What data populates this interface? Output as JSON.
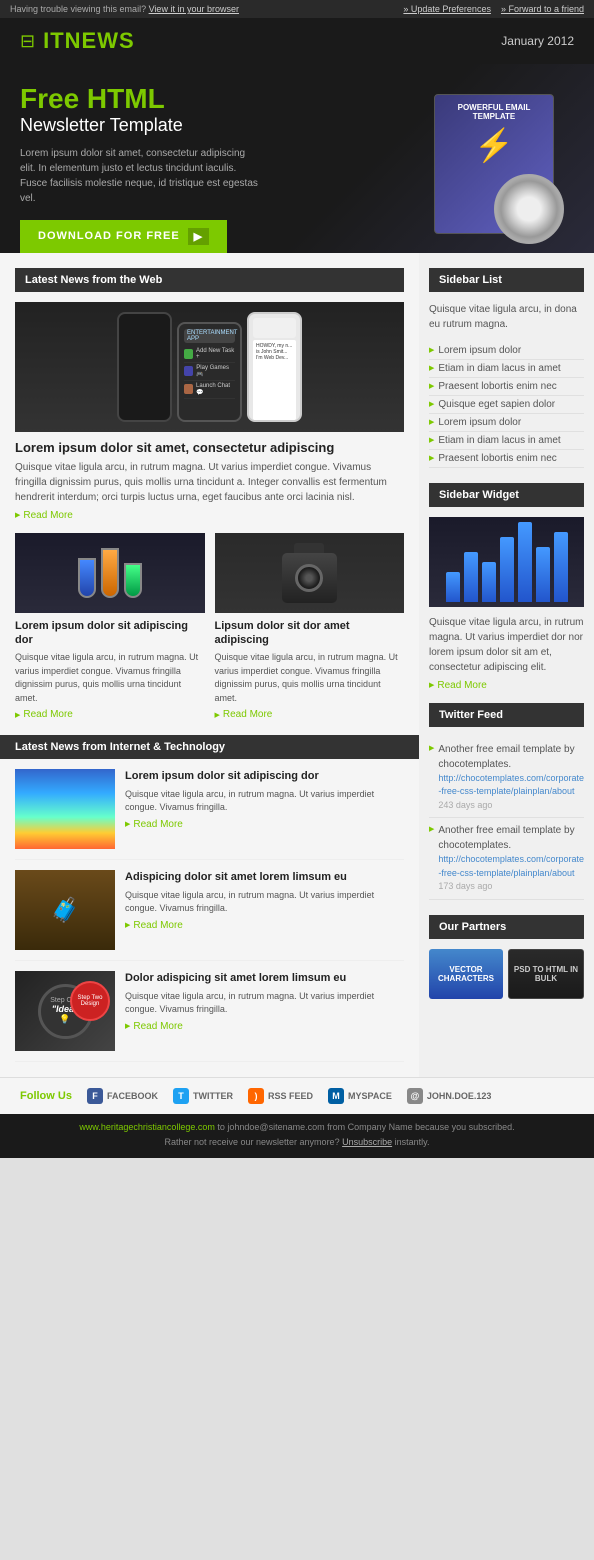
{
  "topbar": {
    "trouble_text": "Having trouble viewing this email?",
    "view_link": "View it in your browser",
    "update_link": "» Update Preferences",
    "forward_link": "» Forward to a friend"
  },
  "header": {
    "logo": "ITNEWS",
    "date": "January 2012"
  },
  "hero": {
    "title": "Free HTML",
    "subtitle": "Newsletter Template",
    "body": "Lorem ipsum dolor sit amet, consectetur adipiscing elit. In elementum justo et lectus tincidunt iaculis. Fusce facilisis molestie neque, id tristique est egestas vel.",
    "btn_label": "DOWNLOAD FOR FREE",
    "cd_title": "POWERFUL EMAIL TEMPLATE"
  },
  "latest_news": {
    "section_title": "Latest News from the Web",
    "article1": {
      "title": "Lorem ipsum dolor sit amet, consectetur adipiscing",
      "body": "Quisque vitae ligula arcu, in rutrum magna. Ut varius imperdiet congue. Vivamus fringilla dignissim purus, quis mollis urna tincidunt a. Integer convallis est fermentum hendrerit interdum; orci turpis luctus urna, eget faucibus ante orci lacinia nisl.",
      "read_more": "Read More"
    },
    "article2": {
      "title": "Lorem ipsum dolor sit adipiscing dor",
      "body": "Quisque vitae ligula arcu, in rutrum magna. Ut varius imperdiet congue. Vivamus fringilla dignissim purus, quis mollis urna tincidunt amet.",
      "read_more": "Read More"
    },
    "article3": {
      "title": "Lipsum dolor sit dor amet adipiscing",
      "body": "Quisque vitae ligula arcu, in rutrum magna. Ut varius imperdiet congue. Vivamus fringilla dignissim purus, quis mollis urna tincidunt amet.",
      "read_more": "Read More"
    }
  },
  "tech_news": {
    "section_title": "Latest News from Internet & Technology",
    "items": [
      {
        "title": "Lorem ipsum dolor sit adipiscing dor",
        "body": "Quisque vitae ligula arcu, in rutrum magna. Ut varius imperdiet congue. Vivamus fringilla.",
        "read_more": "Read More"
      },
      {
        "title": "Adispicing dolor sit amet lorem limsum eu",
        "body": "Quisque vitae ligula arcu, in rutrum magna. Ut varius imperdiet congue. Vivamus fringilla.",
        "read_more": "Read More"
      },
      {
        "title": "Dolor adispicing sit amet lorem limsum eu",
        "body": "Quisque vitae ligula arcu, in rutrum magna. Ut varius imperdiet congue. Vivamus fringilla.",
        "read_more": "Read More"
      }
    ]
  },
  "sidebar": {
    "list_title": "Sidebar List",
    "list_desc": "Quisque vitae ligula arcu, in dona eu rutrum magna.",
    "list_items": [
      "Lorem ipsum dolor",
      "Etiam in diam lacus in amet",
      "Praesent lobortis enim nec",
      "Quisque eget sapien dolor",
      "Lorem ipsum dolor",
      "Etiam in diam lacus in amet",
      "Praesent lobortis enim nec"
    ],
    "widget_title": "Sidebar Widget",
    "widget_desc": "Quisque vitae ligula arcu, in rutrum magna. Ut varius imperdiet dor nor lorem ipsum dolor sit am et, consectetur adipiscing elit.",
    "widget_read_more": "Read More",
    "bars": [
      30,
      50,
      40,
      65,
      80,
      55,
      70
    ],
    "twitter_title": "Twitter Feed",
    "tweets": [
      {
        "text": "Another free email template by chocotemplates.",
        "url": "http://chocotemplates.com/corporate-free-css-template/plainplan/about",
        "time": "243 days ago"
      },
      {
        "text": "Another free email template by chocotemplates.",
        "url": "http://chocotemplates.com/corporate-free-css-template/plainplan/about",
        "time": "173 days ago"
      }
    ],
    "partners_title": "Our Partners",
    "partners": [
      {
        "label": "VECTOR CHARACTERS",
        "type": "vector"
      },
      {
        "label": "PSD TO HTML IN BULK",
        "type": "psd"
      }
    ]
  },
  "follow": {
    "label": "Follow Us",
    "items": [
      {
        "icon": "fb",
        "label": "FACEBOOK"
      },
      {
        "icon": "tw",
        "label": "TWITTER"
      },
      {
        "icon": "rss",
        "label": "RSS FEED"
      },
      {
        "icon": "ms",
        "label": "MYSPACE"
      },
      {
        "icon": "email",
        "label": "JOHN.DOE.123"
      }
    ]
  },
  "footer": {
    "url": "www.heritagechristiancollege.com",
    "text": "to johndoe@sitename.com from Company Name because you subscribed.",
    "unsubscribe_prefix": "Rather not receive our newsletter anymore?",
    "unsubscribe_label": "Unsubscribe",
    "unsubscribe_suffix": "instantly."
  }
}
